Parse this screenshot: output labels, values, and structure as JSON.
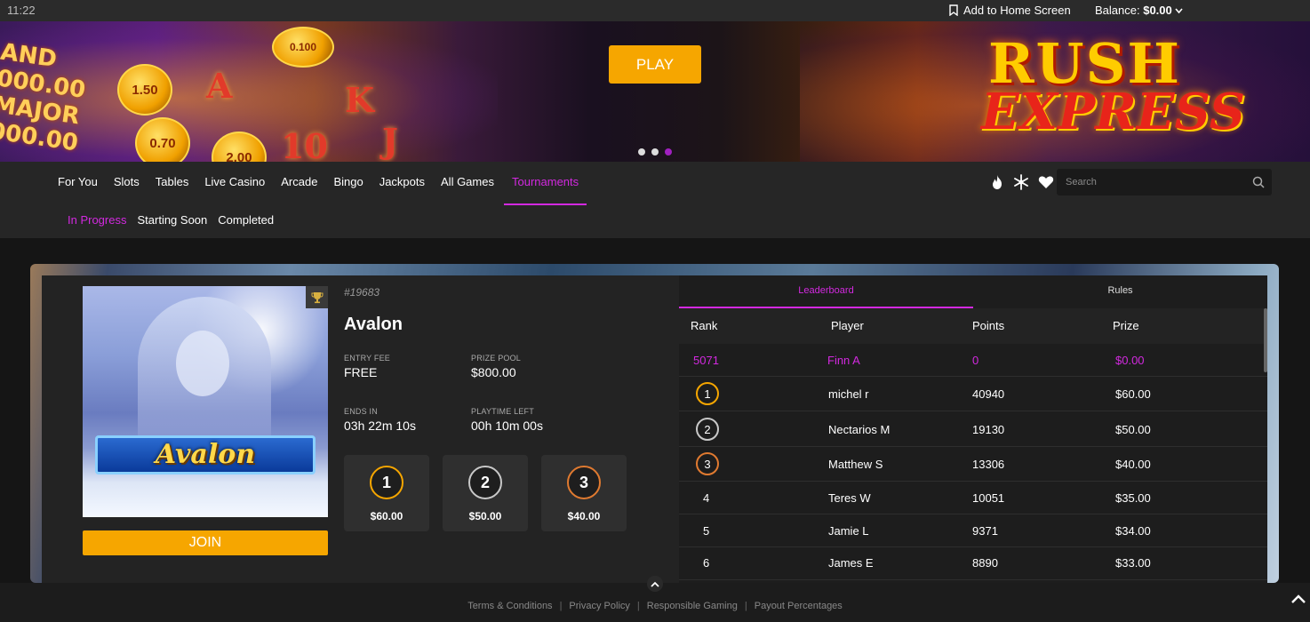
{
  "status": {
    "time": "11:22",
    "add_home": "Add to Home Screen",
    "balance_label": "Balance:",
    "balance_value": "$0.00"
  },
  "banner": {
    "play_label": "PLAY",
    "title_line1": "RUSH",
    "title_line2": "EXPRESS",
    "left_text_1": "AND",
    "left_text_2": "000.00",
    "left_text_3": "MAJOR",
    "left_text_4": "000.00",
    "coin_values": [
      "1.50",
      "0.70",
      "2.00",
      "0.100"
    ],
    "reel_letters": [
      "A",
      "K",
      "10",
      "J"
    ],
    "slides": 3,
    "active_slide": 3
  },
  "nav": {
    "tabs": [
      "For You",
      "Slots",
      "Tables",
      "Live Casino",
      "Arcade",
      "Bingo",
      "Jackpots",
      "All Games",
      "Tournaments"
    ],
    "active_tab": "Tournaments",
    "subtabs": [
      "In Progress",
      "Starting Soon",
      "Completed"
    ],
    "active_subtab": "In Progress",
    "search_placeholder": "Search",
    "icons": [
      "fire-icon",
      "snowflake-icon",
      "heart-icon"
    ]
  },
  "tournament": {
    "id": "#19683",
    "name": "Avalon",
    "game_logo_text": "Avalon",
    "entry_fee_label": "ENTRY FEE",
    "entry_fee": "FREE",
    "prize_pool_label": "PRIZE POOL",
    "prize_pool": "$800.00",
    "ends_in_label": "ENDS IN",
    "ends_in": "03h 22m 10s",
    "playtime_label": "PLAYTIME LEFT",
    "playtime": "00h 10m 00s",
    "prizes": [
      {
        "place": "1",
        "amount": "$60.00"
      },
      {
        "place": "2",
        "amount": "$50.00"
      },
      {
        "place": "3",
        "amount": "$40.00"
      }
    ],
    "join_label": "JOIN"
  },
  "leaderboard": {
    "tabs": [
      "Leaderboard",
      "Rules"
    ],
    "active_tab": "Leaderboard",
    "headers": {
      "rank": "Rank",
      "player": "Player",
      "points": "Points",
      "prize": "Prize"
    },
    "me": {
      "rank": "5071",
      "player": "Finn A",
      "points": "0",
      "prize": "$0.00"
    },
    "rows": [
      {
        "rank": "1",
        "player": "michel r",
        "points": "40940",
        "prize": "$60.00"
      },
      {
        "rank": "2",
        "player": "Nectarios M",
        "points": "19130",
        "prize": "$50.00"
      },
      {
        "rank": "3",
        "player": "Matthew S",
        "points": "13306",
        "prize": "$40.00"
      },
      {
        "rank": "4",
        "player": "Teres W",
        "points": "10051",
        "prize": "$35.00"
      },
      {
        "rank": "5",
        "player": "Jamie L",
        "points": "9371",
        "prize": "$34.00"
      },
      {
        "rank": "6",
        "player": "James E",
        "points": "8890",
        "prize": "$33.00"
      }
    ]
  },
  "footer": {
    "links": [
      "Terms & Conditions",
      "Privacy Policy",
      "Responsible Gaming",
      "Payout Percentages"
    ]
  },
  "colors": {
    "accent": "#d329e0",
    "button": "#f6a600",
    "gold": "#f6a600",
    "silver": "#c8c8c8",
    "bronze": "#e07a30"
  }
}
